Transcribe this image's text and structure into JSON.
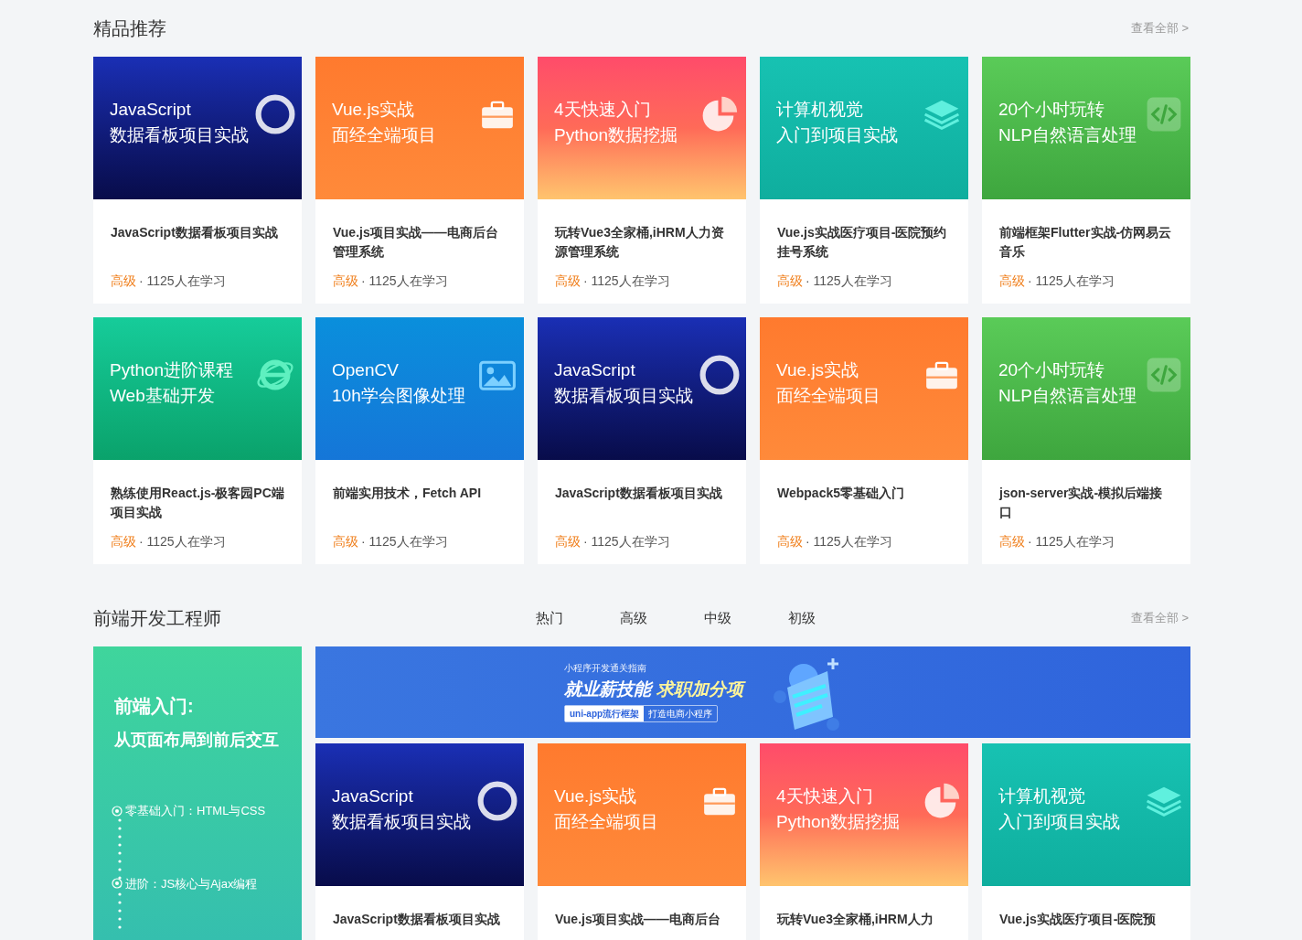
{
  "featured": {
    "title": "精品推荐",
    "view_all": "查看全部 >",
    "courses": [
      {
        "cover": {
          "kind": "js",
          "lines": [
            "JavaScript",
            "数据看板项目实战"
          ]
        },
        "title": "JavaScript数据看板项目实战",
        "level": "高级",
        "learners": "· 1125人在学习"
      },
      {
        "cover": {
          "kind": "vue",
          "lines": [
            "Vue.js实战",
            "面经全端项目"
          ]
        },
        "title": "Vue.js项目实战——电商后台管理系统",
        "level": "高级",
        "learners": "· 1125人在学习"
      },
      {
        "cover": {
          "kind": "python",
          "lines": [
            "4天快速入门",
            "Python数据挖掘"
          ]
        },
        "title": "玩转Vue3全家桶,iHRM人力资源管理系统",
        "level": "高级",
        "learners": "· 1125人在学习"
      },
      {
        "cover": {
          "kind": "cv",
          "lines": [
            "计算机视觉",
            "入门到项目实战"
          ]
        },
        "title": "Vue.js实战医疗项目-医院预约挂号系统",
        "level": "高级",
        "learners": "· 1125人在学习"
      },
      {
        "cover": {
          "kind": "nlp",
          "lines": [
            "20个小时玩转",
            "NLP自然语言处理"
          ]
        },
        "title": "前端框架Flutter实战-仿网易云音乐",
        "level": "高级",
        "learners": "· 1125人在学习"
      },
      {
        "cover": {
          "kind": "pyweb",
          "lines": [
            "Python进阶课程",
            "Web基础开发"
          ]
        },
        "title": "熟练使用React.js-极客园PC端项目实战",
        "level": "高级",
        "learners": "· 1125人在学习"
      },
      {
        "cover": {
          "kind": "opencv",
          "lines": [
            "OpenCV",
            "10h学会图像处理"
          ]
        },
        "title": "前端实用技术，Fetch API",
        "level": "高级",
        "learners": "· 1125人在学习"
      },
      {
        "cover": {
          "kind": "js",
          "lines": [
            "JavaScript",
            "数据看板项目实战"
          ]
        },
        "title": "JavaScript数据看板项目实战",
        "level": "高级",
        "learners": "· 1125人在学习"
      },
      {
        "cover": {
          "kind": "vue",
          "lines": [
            "Vue.js实战",
            "面经全端项目"
          ]
        },
        "title": "Webpack5零基础入门",
        "level": "高级",
        "learners": "· 1125人在学习"
      },
      {
        "cover": {
          "kind": "nlp",
          "lines": [
            "20个小时玩转",
            "NLP自然语言处理"
          ]
        },
        "title": "json-server实战-模拟后端接口",
        "level": "高级",
        "learners": "· 1125人在学习"
      }
    ]
  },
  "frontend": {
    "title": "前端开发工程师",
    "tabs": [
      {
        "label": "热门",
        "selected": false
      },
      {
        "label": "高级",
        "selected": false
      },
      {
        "label": "中级",
        "selected": false
      },
      {
        "label": "初级",
        "selected": false
      }
    ],
    "view_all": "查看全部 >",
    "path": {
      "heading": "前端入门:",
      "subheading": "从页面布局到前后交互",
      "steps": [
        "零基础入门：HTML与CSS",
        "进阶：JS核心与Ajax编程"
      ]
    },
    "banner": {
      "eyebrow": "小程序开发通关指南",
      "headline": "就业薪技能",
      "highlight": "求职加分项",
      "tags": [
        "uni-app流行框架",
        "打造电商小程序"
      ]
    },
    "courses": [
      {
        "cover": {
          "kind": "js",
          "lines": [
            "JavaScript",
            "数据看板项目实战"
          ]
        },
        "title": "JavaScript数据看板项目实战"
      },
      {
        "cover": {
          "kind": "vue",
          "lines": [
            "Vue.js实战",
            "面经全端项目"
          ]
        },
        "title": "Vue.js项目实战——电商后台"
      },
      {
        "cover": {
          "kind": "python",
          "lines": [
            "4天快速入门",
            "Python数据挖掘"
          ]
        },
        "title": "玩转Vue3全家桶,iHRM人力"
      },
      {
        "cover": {
          "kind": "cv",
          "lines": [
            "计算机视觉",
            "入门到项目实战"
          ]
        },
        "title": "Vue.js实战医疗项目-医院预"
      }
    ]
  }
}
